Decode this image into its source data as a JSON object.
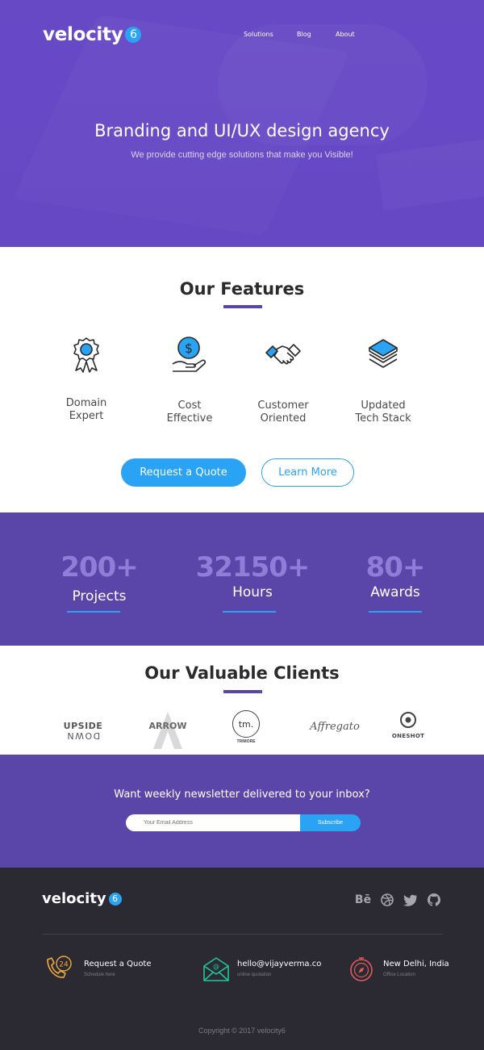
{
  "brand": {
    "name": "velocity",
    "badge": "6"
  },
  "nav": {
    "items": [
      "Solutions",
      "Blog",
      "About"
    ]
  },
  "hero": {
    "title": "Branding and UI/UX design agency",
    "subtitle": "We provide cutting edge solutions that make you Visible!"
  },
  "features": {
    "title": "Our Features",
    "items": [
      {
        "line1": "Domain",
        "line2": "Expert",
        "icon": "award-ribbon-icon"
      },
      {
        "line1": "Cost",
        "line2": "Effective",
        "icon": "dollar-hand-icon"
      },
      {
        "line1": "Customer",
        "line2": "Oriented",
        "icon": "handshake-icon"
      },
      {
        "line1": "Updated",
        "line2": "Tech Stack",
        "icon": "layers-stack-icon"
      }
    ],
    "quote_button": "Request a Quote",
    "more_button": "Learn More"
  },
  "stats": [
    {
      "value": "200+",
      "label": "Projects"
    },
    {
      "value": "32150+",
      "label": "Hours"
    },
    {
      "value": "80+",
      "label": "Awards"
    }
  ],
  "clients": {
    "title": "Our Valuable Clients",
    "logos": [
      {
        "line1": "UPSIDE",
        "line2": "DOWN"
      },
      {
        "line1": "ARROW",
        "line2": ""
      },
      {
        "line1": "tm.",
        "line2": "TRIMORE"
      },
      {
        "line1": "Affregato",
        "line2": ""
      },
      {
        "line1": "",
        "line2": "ONESHOT"
      }
    ]
  },
  "newsletter": {
    "title": "Want weekly newsletter delivered to your inbox?",
    "placeholder": "Your Email Address",
    "button": "Subscribe"
  },
  "footer": {
    "social": [
      "behance-icon",
      "dribbble-icon",
      "twitter-icon",
      "github-icon"
    ],
    "contacts": [
      {
        "title": "Request a Quote",
        "sub": "Schedule here",
        "icon": "phone-24-icon"
      },
      {
        "title": "hello@vijayverma.co",
        "sub": "online quotation",
        "icon": "mail-icon"
      },
      {
        "title": "New Delhi, India",
        "sub": "Office Location",
        "icon": "compass-location-icon"
      }
    ],
    "copyright": "Copyright © 2017 velocity6"
  },
  "colors": {
    "brand_purple": "#5a46a8",
    "accent_blue": "#2aa3f5",
    "footer_dark": "#2b2a33"
  }
}
